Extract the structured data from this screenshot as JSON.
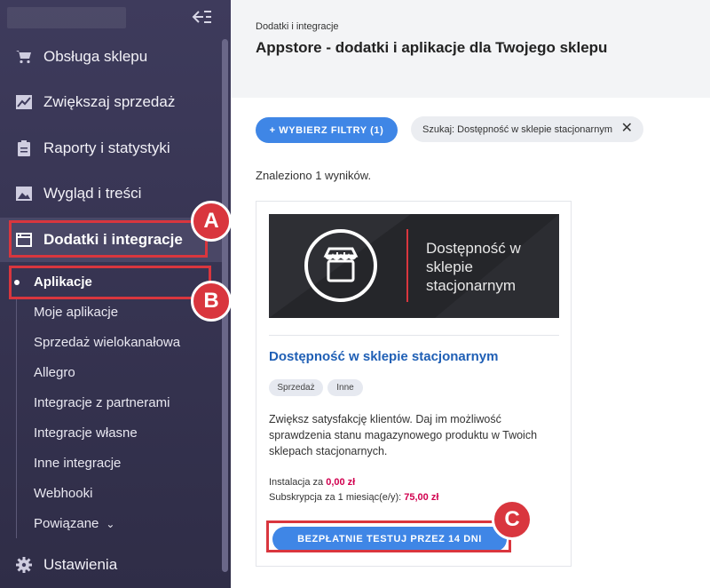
{
  "sidebar": {
    "menu": [
      {
        "label": "Obsługa sklepu",
        "icon": "cart-icon"
      },
      {
        "label": "Zwiększaj sprzedaż",
        "icon": "trend-chart-icon"
      },
      {
        "label": "Raporty i statystyki",
        "icon": "clipboard-icon"
      },
      {
        "label": "Wygląd i treści",
        "icon": "image-icon"
      },
      {
        "label": "Dodatki i integracje",
        "icon": "window-icon"
      }
    ],
    "submenu": [
      "Aplikacje",
      "Moje aplikacje",
      "Sprzedaż wielokanałowa",
      "Allegro",
      "Integracje z partnerami",
      "Integracje własne",
      "Inne integracje",
      "Webhooki",
      "Powiązane"
    ],
    "settings_label": "Ustawienia",
    "collapse_icon": "collapse-sidebar-icon"
  },
  "annotations": {
    "a": "A",
    "b": "B",
    "c": "C",
    "color": "#d9363e"
  },
  "header": {
    "breadcrumb": "Dodatki i integracje",
    "title": "Appstore - dodatki i aplikacje dla Twojego sklepu"
  },
  "filters": {
    "button_label": "+ WYBIERZ FILTRY (1)",
    "search_chip": "Szukaj: Dostępność w sklepie stacjonarnym"
  },
  "results_text": "Znaleziono 1 wyników.",
  "card": {
    "banner_text": "Dostępność w sklepie stacjonarnym",
    "title": "Dostępność w sklepie stacjonarnym",
    "tags": [
      "Sprzedaż",
      "Inne"
    ],
    "description": "Zwiększ satysfakcję klientów. Daj im możliwość sprawdzenia stanu magazynowego produktu w Twoich sklepach stacjonarnych.",
    "install_label": "Instalacja za",
    "install_price": "0,00 zł",
    "subscription_label": "Subskrypcja za 1 miesiąc(e/y):",
    "subscription_price": "75,00 zł",
    "cta": "BEZPŁATNIE TESTUJ PRZEZ 14 DNI"
  },
  "colors": {
    "accent": "#3f86e6",
    "price": "#d1004f",
    "sidebar": "#3e3b5c"
  }
}
